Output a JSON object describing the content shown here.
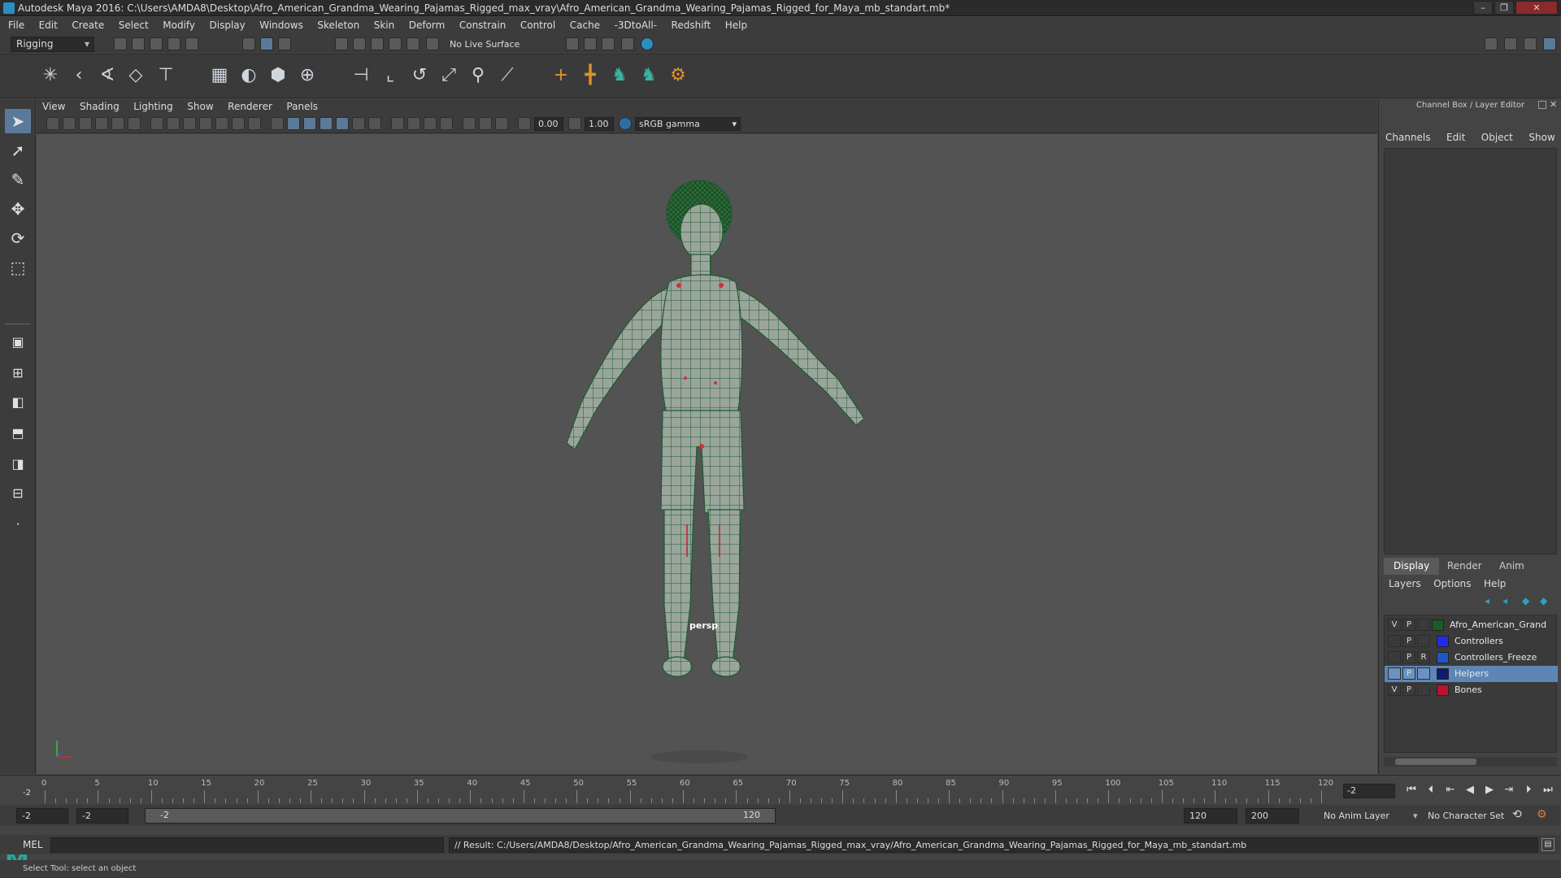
{
  "window": {
    "title": "Autodesk Maya 2016: C:\\Users\\AMDA8\\Desktop\\Afro_American_Grandma_Wearing_Pajamas_Rigged_max_vray\\Afro_American_Grandma_Wearing_Pajamas_Rigged_for_Maya_mb_standart.mb*"
  },
  "menubar": [
    "File",
    "Edit",
    "Create",
    "Select",
    "Modify",
    "Display",
    "Windows",
    "Skeleton",
    "Skin",
    "Deform",
    "Constrain",
    "Control",
    "Cache",
    "-3DtoAll-",
    "Redshift",
    "Help"
  ],
  "statusline": {
    "mode": "Rigging",
    "live_surface": "No Live Surface"
  },
  "viewport": {
    "menu": [
      "View",
      "Shading",
      "Lighting",
      "Show",
      "Renderer",
      "Panels"
    ],
    "exposure": "0.00",
    "gamma": "1.00",
    "color_space": "sRGB gamma",
    "camera_label": "persp"
  },
  "channel_box": {
    "title": "Channel Box / Layer Editor",
    "tabs": [
      "Channels",
      "Edit",
      "Object",
      "Show"
    ]
  },
  "layer_editor": {
    "tabs": [
      "Display",
      "Render",
      "Anim"
    ],
    "active_tab": "Display",
    "menu": [
      "Layers",
      "Options",
      "Help"
    ],
    "layers": [
      {
        "v": "V",
        "p": "P",
        "r": "",
        "name": "Afro_American_Grandma",
        "color": "#1c5a2a",
        "selected": false
      },
      {
        "v": "",
        "p": "P",
        "r": "",
        "name": "Controllers",
        "color": "#1f2cf0",
        "selected": false
      },
      {
        "v": "",
        "p": "P",
        "r": "R",
        "name": "Controllers_Freeze",
        "color": "#1c58c8",
        "selected": false
      },
      {
        "v": "",
        "p": "P",
        "r": "",
        "name": "Helpers",
        "color": "#101a70",
        "selected": true
      },
      {
        "v": "V",
        "p": "P",
        "r": "",
        "name": "Bones",
        "color": "#c01030",
        "selected": false
      }
    ]
  },
  "timeline": {
    "ticks": [
      0,
      5,
      10,
      15,
      20,
      25,
      30,
      35,
      40,
      45,
      50,
      55,
      60,
      65,
      70,
      75,
      80,
      85,
      90,
      95,
      100,
      105,
      110,
      115,
      120
    ],
    "current_marker": "-2",
    "current_frame": "-2"
  },
  "range": {
    "start": "-2",
    "playback_start": "-2",
    "slider_start": "-2",
    "slider_end": "120",
    "playback_end": "120",
    "end": "200",
    "anim_layer": "No Anim Layer",
    "character_set": "No Character Set"
  },
  "command": {
    "label": "MEL",
    "result": "// Result: C:/Users/AMDA8/Desktop/Afro_American_Grandma_Wearing_Pajamas_Rigged_max_vray/Afro_American_Grandma_Wearing_Pajamas_Rigged_for_Maya_mb_standart.mb"
  },
  "help_line": "Select Tool: select an object"
}
